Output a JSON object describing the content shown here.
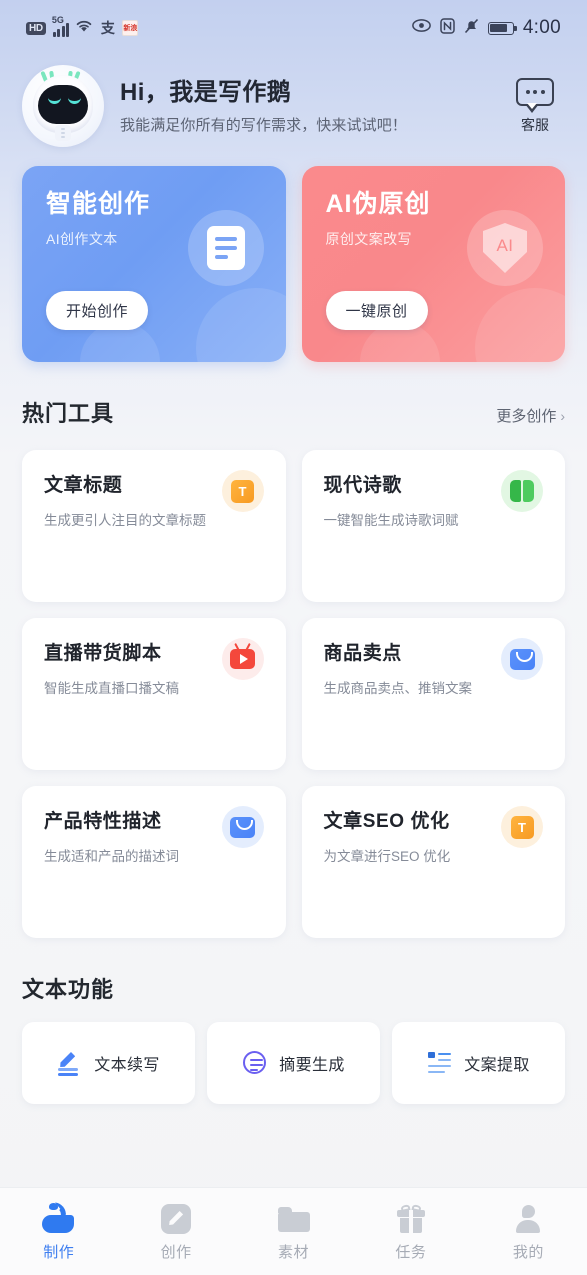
{
  "status_bar": {
    "hd_label": "HD",
    "network": "5G",
    "time": "4:00",
    "icons": [
      "hd-badge",
      "signal-bars-icon",
      "wifi-icon",
      "alipay-icon",
      "app-badge-icon",
      "eye-icon",
      "nfc-icon",
      "bell-muted-icon",
      "battery-icon"
    ]
  },
  "header": {
    "title": "Hi，我是写作鹅",
    "subtitle": "我能满足你所有的写作需求，快来试试吧！",
    "avatar_icon": "robot-mascot-avatar",
    "service_label": "客服",
    "service_icon": "chat-bubble-icon"
  },
  "banners": [
    {
      "title": "智能创作",
      "subtitle": "AI创作文本",
      "cta": "开始创作",
      "icon": "document-icon",
      "color": "#7ba4f5"
    },
    {
      "title": "AI伪原创",
      "subtitle": "原创文案改写",
      "cta": "一键原创",
      "icon": "shield-ai-icon",
      "badge_text": "AI",
      "color": "#fa8a8c"
    }
  ],
  "hot_tools": {
    "section_title": "热门工具",
    "more_label": "更多创作",
    "more_chevron": "›",
    "items": [
      {
        "title": "文章标题",
        "desc": "生成更引人注目的文章标题",
        "icon": "title-t-icon",
        "icon_glyph": "T",
        "color": "#f79a22"
      },
      {
        "title": "现代诗歌",
        "desc": "一键智能生成诗歌词赋",
        "icon": "open-book-icon",
        "color": "#3fc052"
      },
      {
        "title": "直播带货脚本",
        "desc": "智能生成直播口播文稿",
        "icon": "live-tv-icon",
        "color": "#f4483c"
      },
      {
        "title": "商品卖点",
        "desc": "生成商品卖点、推销文案",
        "icon": "shopping-bag-icon",
        "color": "#4a83f7"
      },
      {
        "title": "产品特性描述",
        "desc": "生成适和产品的描述词",
        "icon": "shopping-bag-icon",
        "color": "#4a83f7"
      },
      {
        "title": "文章SEO 优化",
        "desc": "为文章进行SEO 优化",
        "icon": "title-t-icon",
        "icon_glyph": "T",
        "color": "#f79a22"
      }
    ]
  },
  "text_functions": {
    "section_title": "文本功能",
    "items": [
      {
        "label": "文本续写",
        "icon": "pencil-write-icon",
        "color": "#4a83f7"
      },
      {
        "label": "摘要生成",
        "icon": "summary-circle-icon",
        "color": "#6a5ff0"
      },
      {
        "label": "文案提取",
        "icon": "extract-list-icon",
        "color": "#4a90f0"
      }
    ]
  },
  "tabbar": {
    "items": [
      {
        "label": "制作",
        "icon": "swan-icon",
        "active": true
      },
      {
        "label": "创作",
        "icon": "pencil-square-icon",
        "active": false
      },
      {
        "label": "素材",
        "icon": "folder-icon",
        "active": false
      },
      {
        "label": "任务",
        "icon": "gift-icon",
        "active": false
      },
      {
        "label": "我的",
        "icon": "person-icon",
        "active": false
      }
    ],
    "active_color": "#3d7ef0"
  }
}
